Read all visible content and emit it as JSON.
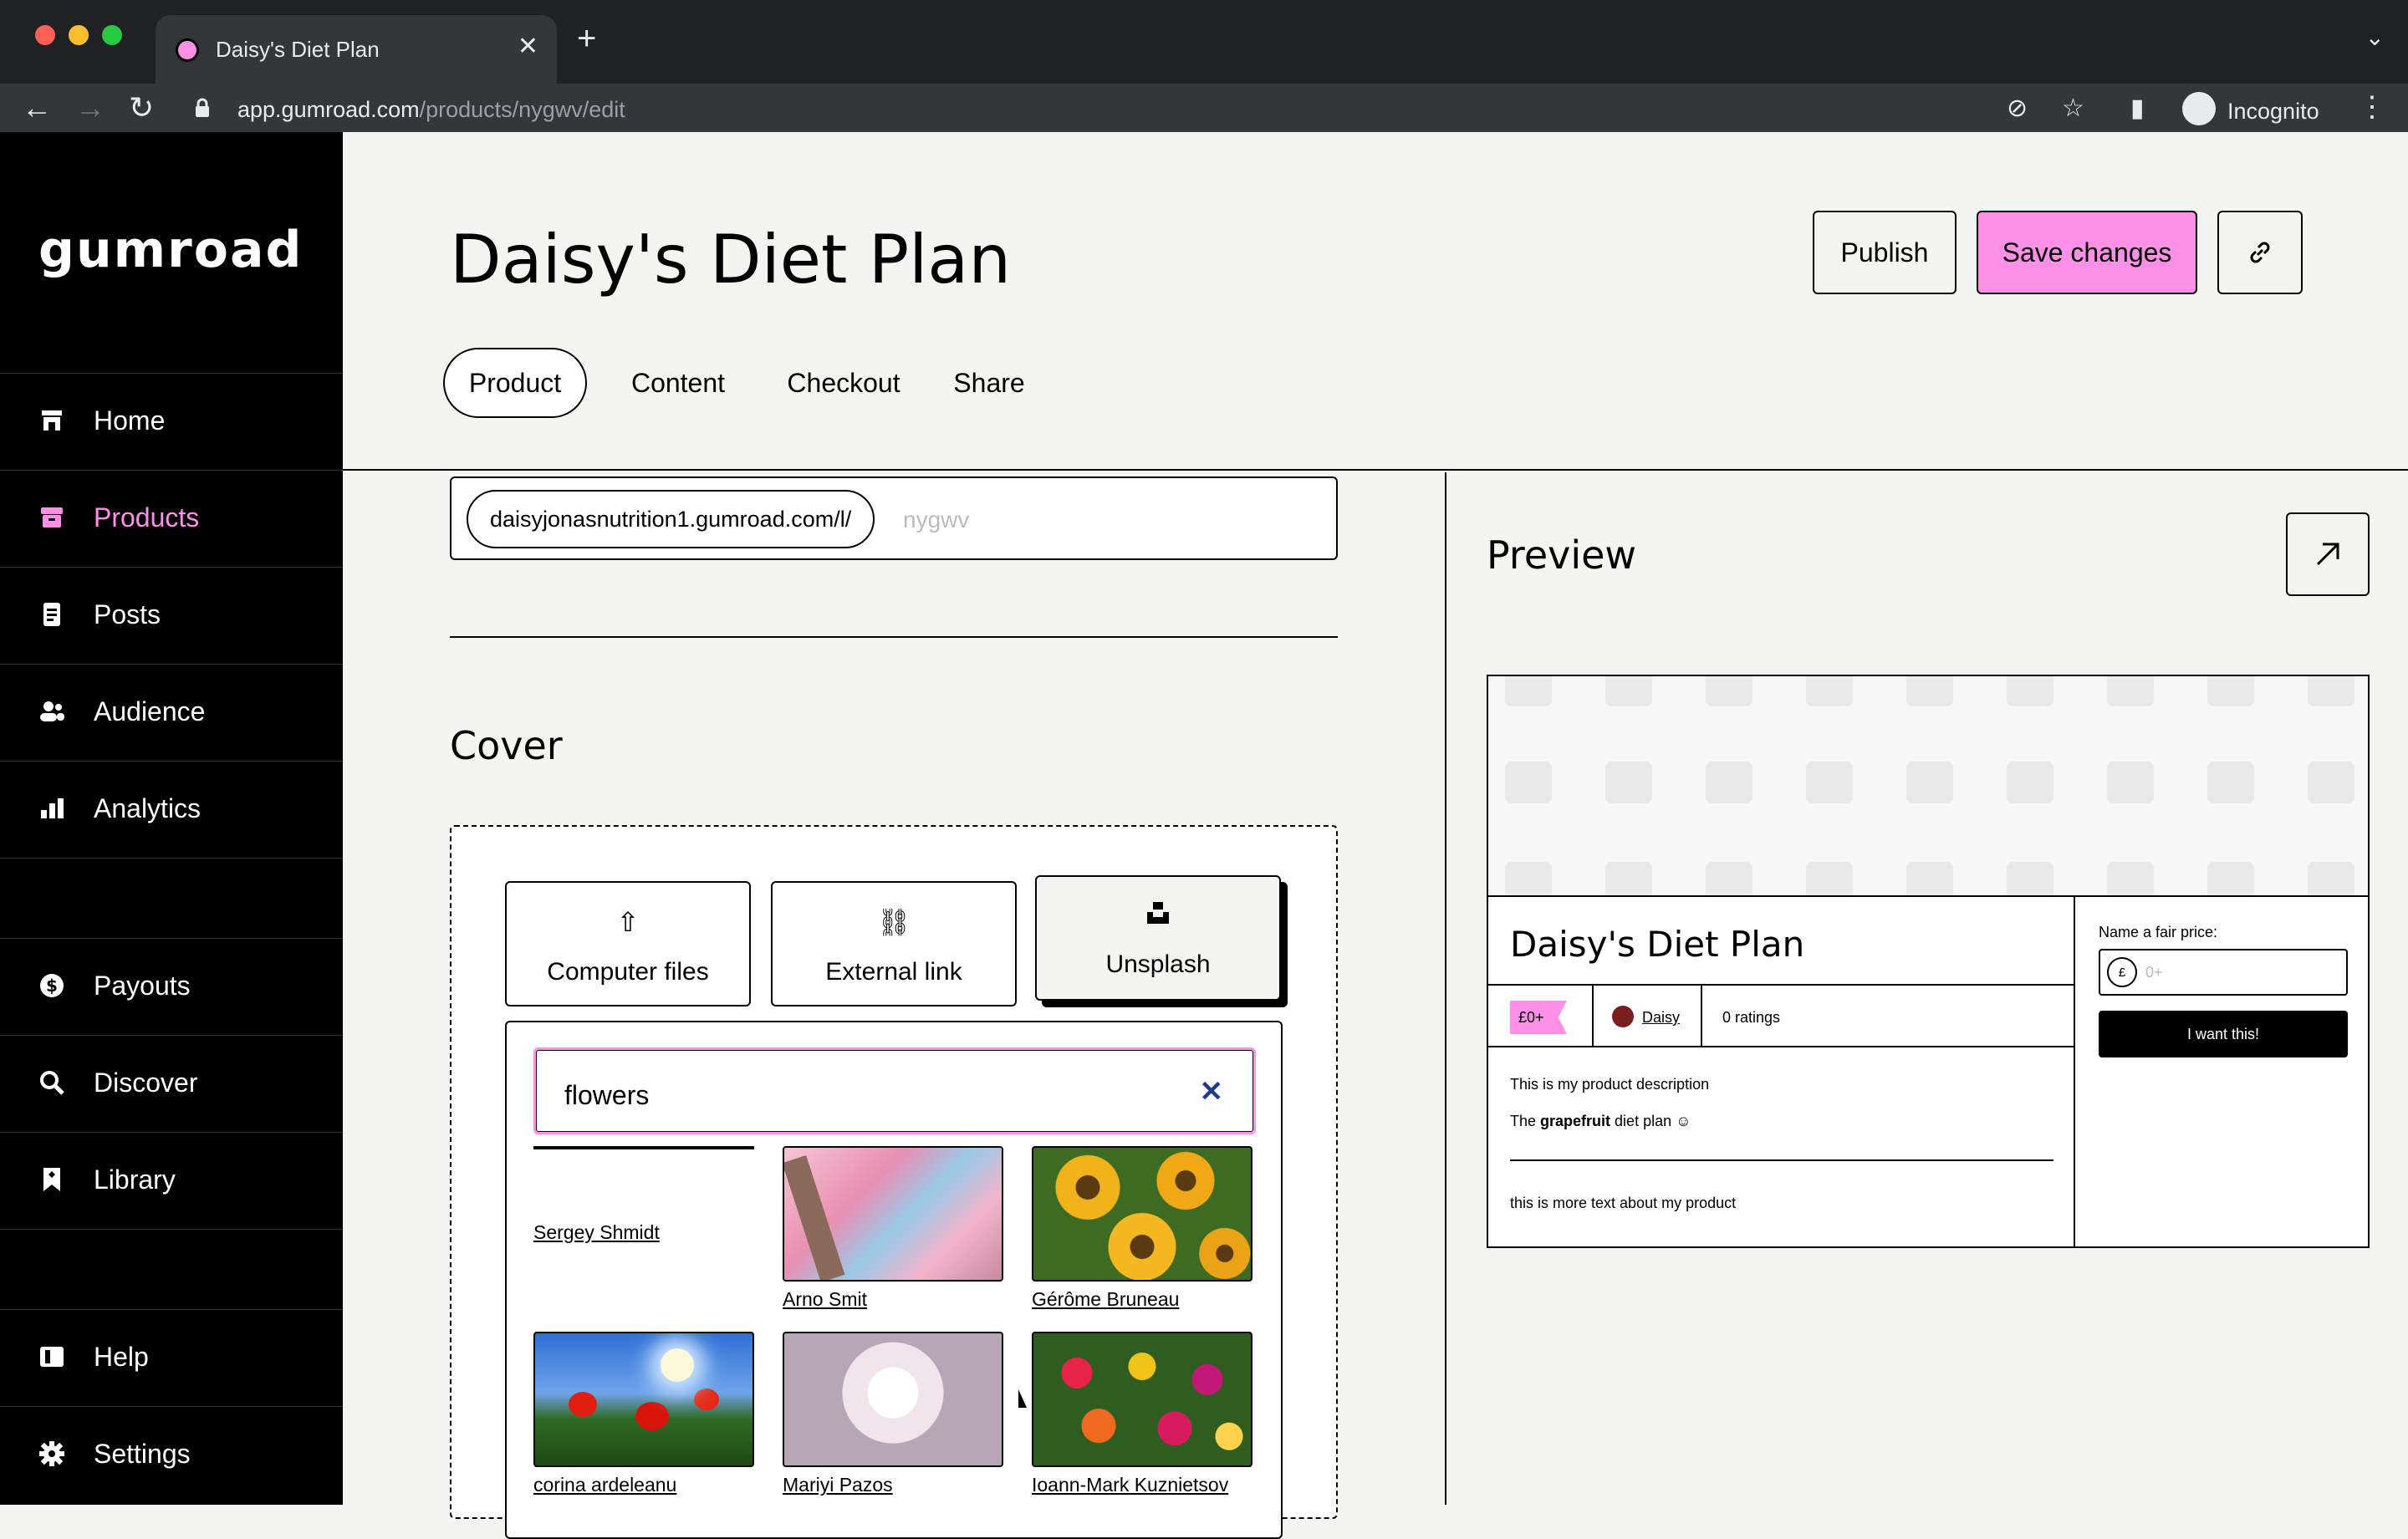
{
  "browser": {
    "tab_title": "Daisy's Diet Plan",
    "url_host": "app.gumroad.com",
    "url_path": "/products/nygwv/edit",
    "profile_label": "Incognito"
  },
  "sidebar": {
    "logo": "gumroad",
    "items": [
      {
        "label": "Home",
        "icon": "store-icon"
      },
      {
        "label": "Products",
        "icon": "archive-icon"
      },
      {
        "label": "Posts",
        "icon": "document-icon"
      },
      {
        "label": "Audience",
        "icon": "people-icon"
      },
      {
        "label": "Analytics",
        "icon": "bar-chart-icon"
      },
      {
        "label": "Payouts",
        "icon": "dollar-icon"
      },
      {
        "label": "Discover",
        "icon": "search-icon"
      },
      {
        "label": "Library",
        "icon": "bookmark-icon"
      },
      {
        "label": "Help",
        "icon": "book-icon"
      },
      {
        "label": "Settings",
        "icon": "gear-icon"
      }
    ],
    "active_label": "Products"
  },
  "header": {
    "title": "Daisy's Diet Plan",
    "publish_label": "Publish",
    "save_label": "Save changes",
    "tabs": [
      "Product",
      "Content",
      "Checkout",
      "Share"
    ],
    "selected_tab": "Product"
  },
  "editor": {
    "url_prefix": "daisyjonasnutrition1.gumroad.com/l/",
    "permalink_placeholder": "nygwv",
    "cover_heading": "Cover",
    "sources": [
      "Computer files",
      "External link",
      "Unsplash"
    ],
    "selected_source": "Unsplash",
    "search_value": "flowers",
    "photos": [
      {
        "credit": "Sergey Shmidt"
      },
      {
        "credit": "Arno Smit"
      },
      {
        "credit": "Gérôme Bruneau"
      },
      {
        "credit": "corina ardeleanu"
      },
      {
        "credit": "Mariyi Pazos"
      },
      {
        "credit": "Ioann-Mark Kuznietsov"
      }
    ]
  },
  "preview": {
    "heading": "Preview",
    "product_title": "Daisy's Diet Plan",
    "price_tag": "£0+",
    "creator": "Daisy",
    "ratings": "0 ratings",
    "description_1": "This is my product description",
    "description_2_pre": "The ",
    "description_2_bold": "grapefruit",
    "description_2_post": " diet plan ☺",
    "description_3": "this is more text about my product",
    "price_label": "Name a fair price:",
    "currency": "£",
    "price_placeholder": "0+",
    "cta": "I want this!"
  },
  "colors": {
    "accent": "#ff90e8",
    "sidebar_bg": "#000000",
    "page_bg": "#f4f4f0"
  }
}
